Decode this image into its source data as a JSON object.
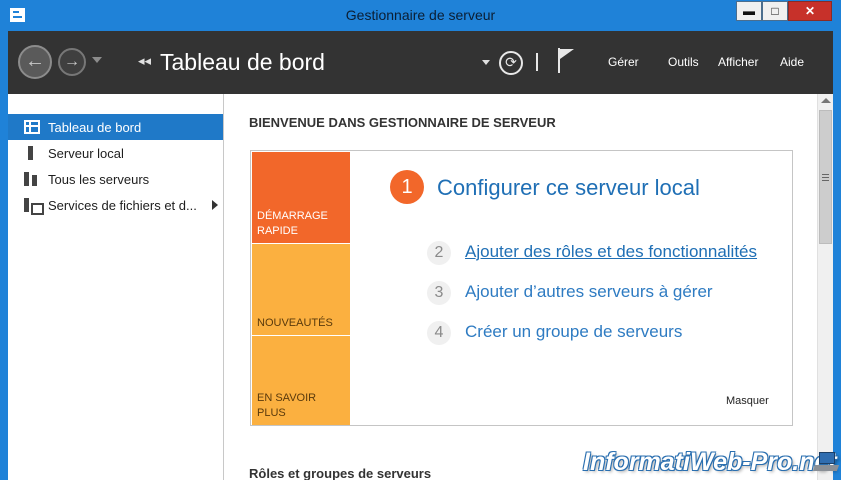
{
  "window": {
    "title": "Gestionnaire de serveur",
    "controls": {
      "minimize": "▬",
      "maximize": "□",
      "close": "✕"
    }
  },
  "toolbar": {
    "breadcrumb_arrows": "◂◂",
    "breadcrumb_title": "Tableau de bord",
    "menu": {
      "gerer": "Gérer",
      "outils": "Outils",
      "afficher": "Afficher",
      "aide": "Aide"
    }
  },
  "sidebar": {
    "items": [
      {
        "label": "Tableau de bord",
        "icon": "dashboard-icon",
        "active": true
      },
      {
        "label": "Serveur local",
        "icon": "server-icon"
      },
      {
        "label": "Tous les serveurs",
        "icon": "servers-icon"
      },
      {
        "label": "Services de fichiers et d...",
        "icon": "file-services-icon"
      }
    ]
  },
  "main": {
    "welcome_heading": "BIENVENUE DANS GESTIONNAIRE DE SERVEUR",
    "tiles": {
      "quick_start": "DÉMARRAGE RAPIDE",
      "whats_new": "NOUVEAUTÉS",
      "learn_more": "EN SAVOIR PLUS"
    },
    "steps": [
      {
        "num": "1",
        "label": "Configurer ce serveur local"
      },
      {
        "num": "2",
        "label": "Ajouter des rôles et des fonctionnalités"
      },
      {
        "num": "3",
        "label": "Ajouter d’autres serveurs à gérer"
      },
      {
        "num": "4",
        "label": "Créer un groupe de serveurs"
      }
    ],
    "hide_label": "Masquer",
    "roles_heading": "Rôles et groupes de serveurs"
  },
  "colors": {
    "titlebar": "#1f82d8",
    "toolbar": "#333333",
    "sidebar_active": "#1f79c8",
    "quick_start_tile": "#f2672a",
    "tiles_secondary": "#fbb040",
    "link_blue": "#1f6fb5"
  },
  "watermark": "InformatiWeb-Pro.net"
}
